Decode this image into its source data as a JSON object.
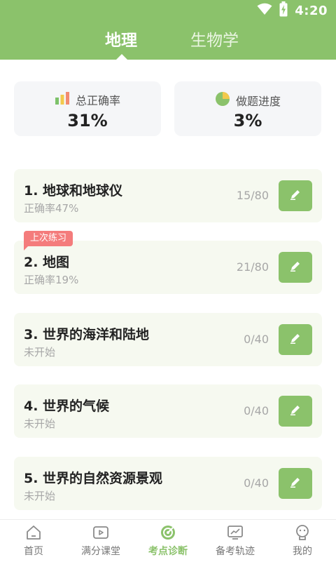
{
  "status_bar": {
    "time": "4:20"
  },
  "header": {
    "tabs": [
      {
        "label": "地理",
        "active": true
      },
      {
        "label": "生物学",
        "active": false
      }
    ]
  },
  "stats": {
    "accuracy": {
      "label": "总正确率",
      "value": "31%"
    },
    "progress": {
      "label": "做题进度",
      "value": "3%"
    }
  },
  "last_practice_badge": "上次练习",
  "chapters": [
    {
      "title": "1. 地球和地球仪",
      "subtitle": "正确率47%",
      "progress": "15/80"
    },
    {
      "title": "2. 地图",
      "subtitle": "正确率19%",
      "progress": "21/80"
    },
    {
      "title": "3. 世界的海洋和陆地",
      "subtitle": "未开始",
      "progress": "0/40"
    },
    {
      "title": "4. 世界的气候",
      "subtitle": "未开始",
      "progress": "0/40"
    },
    {
      "title": "5. 世界的自然资源景观",
      "subtitle": "未开始",
      "progress": "0/40"
    }
  ],
  "bottom_nav": [
    {
      "label": "首页",
      "icon": "home-icon"
    },
    {
      "label": "满分课堂",
      "icon": "video-icon"
    },
    {
      "label": "考点诊断",
      "icon": "target-icon",
      "active": true
    },
    {
      "label": "备考轨迹",
      "icon": "trend-icon"
    },
    {
      "label": "我的",
      "icon": "profile-icon"
    }
  ],
  "colors": {
    "brand_green": "#8bc26b",
    "badge_red": "#f47c7c",
    "card_bg": "#f6f9f0"
  }
}
